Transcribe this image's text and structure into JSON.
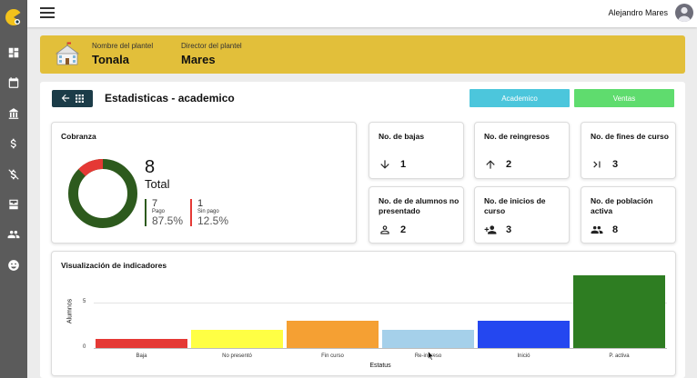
{
  "topbar": {
    "username": "Alejandro Mares"
  },
  "banner": {
    "school_label": "Nombre del plantel",
    "school_name": "Tonala",
    "director_label": "Director del plantel",
    "director_name": "Mares"
  },
  "page": {
    "title": "Estadisticas - academico",
    "tab_academico": "Academico",
    "tab_ventas": "Ventas"
  },
  "colors": {
    "banner": "#e2bf3a",
    "tab_academico": "#4cc6dc",
    "tab_ventas": "#5fdc6e",
    "back_button": "#1b3c48",
    "pago": "#2d5a1d",
    "sin_pago": "#e53935"
  },
  "cobranza": {
    "title": "Cobranza",
    "total": "8",
    "total_label": "Total",
    "pago_count": "7",
    "pago_label": "Pago",
    "pago_pct": "87.5%",
    "sin_pago_count": "1",
    "sin_pago_label": "Sin pago",
    "sin_pago_pct": "12.5%"
  },
  "stats": [
    {
      "title": "No. de bajas",
      "value": "1",
      "icon": "arrow-down-icon"
    },
    {
      "title": "No. de reingresos",
      "value": "2",
      "icon": "arrow-up-icon"
    },
    {
      "title": "No. de fines de curso",
      "value": "3",
      "icon": "skip-end-icon"
    },
    {
      "title": "No. de de alumnos no presentado",
      "value": "2",
      "icon": "person-outline-icon"
    },
    {
      "title": "No. de inicios de curso",
      "value": "3",
      "icon": "person-add-icon"
    },
    {
      "title": "No. de población activa",
      "value": "8",
      "icon": "group-icon"
    }
  ],
  "indicators": {
    "title": "Visualización de indicadores"
  },
  "chart_data": {
    "type": "bar",
    "categories": [
      "Baja",
      "No presentó",
      "Fin curso",
      "Re-ingreso",
      "Inició",
      "P. activa"
    ],
    "values": [
      1,
      2,
      3,
      2,
      3,
      8
    ],
    "colors": [
      "#e53935",
      "#ffff44",
      "#f5a033",
      "#a5d0ea",
      "#2447f0",
      "#2e7d22"
    ],
    "xlabel": "Estatus",
    "ylabel": "Alumnos",
    "yticks": [
      "0",
      "5"
    ],
    "ylim": [
      0,
      8
    ],
    "grid": true
  }
}
